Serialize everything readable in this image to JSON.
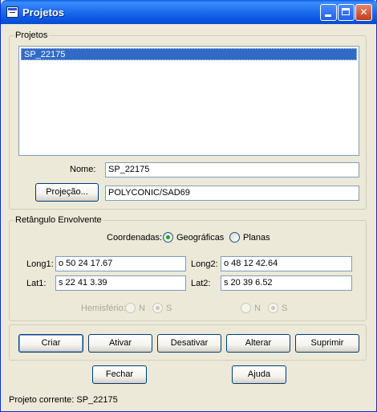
{
  "window": {
    "title": "Projetos",
    "minimize_label": "_",
    "maximize_label": "□",
    "close_label": "✕"
  },
  "projects_group": {
    "legend": "Projetos",
    "list_items": [
      "SP_22175"
    ],
    "name_label": "Nome:",
    "name_value": "SP_22175",
    "projection_button": "Projeção...",
    "projection_value": "POLYCONIC/SAD69"
  },
  "rect_group": {
    "legend": "Retângulo Envolvente",
    "coords_label": "Coordenadas:",
    "coords_options": [
      "Geográficas",
      "Planas"
    ],
    "coords_selected": "Geográficas",
    "long1_label": "Long1:",
    "long1_value": "o 50  24  17.67",
    "long2_label": "Long2:",
    "long2_value": "o 48  12  42.64",
    "lat1_label": "Lat1:",
    "lat1_value": "s 22  41  3.39",
    "lat2_label": "Lat2:",
    "lat2_value": "s 20  39  6.52",
    "hemisphere_label": "Hemisfério:",
    "hemisphere_left": {
      "options": [
        "N",
        "S"
      ],
      "selected": "S"
    },
    "hemisphere_right": {
      "options": [
        "N",
        "S"
      ],
      "selected": "S"
    }
  },
  "actions": {
    "create": "Criar",
    "activate": "Ativar",
    "deactivate": "Desativar",
    "modify": "Alterar",
    "delete": "Suprimir"
  },
  "footer": {
    "close": "Fechar",
    "help": "Ajuda",
    "status": "Projeto corrente: SP_22175"
  },
  "colors": {
    "titlebar": "#0a5fe0",
    "selection": "#316ac5",
    "window_bg": "#ece9d8"
  }
}
